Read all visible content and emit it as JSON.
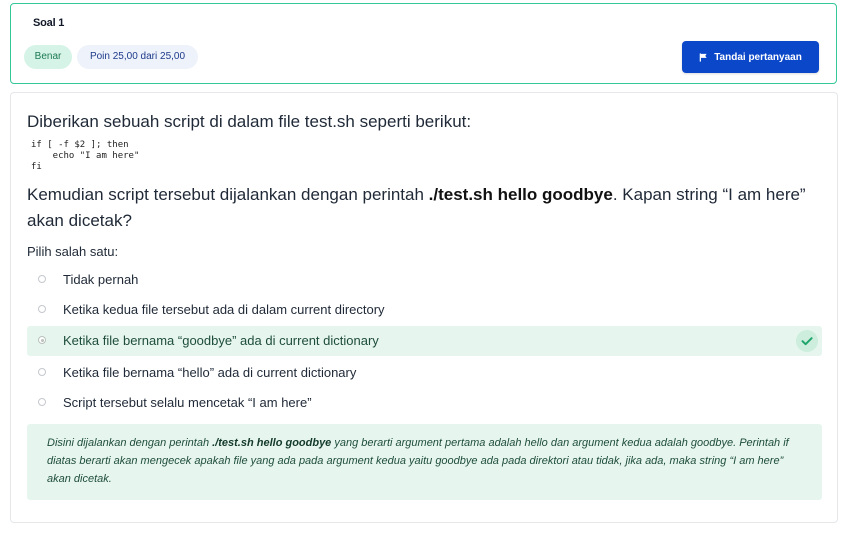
{
  "header": {
    "title": "Soal 1",
    "status_badge": "Benar",
    "points_badge": "Poin 25,00 dari 25,00",
    "flag_button": "Tandai pertanyaan"
  },
  "question": {
    "intro": "Diberikan sebuah script di dalam file test.sh seperti berikut:",
    "code": "if [ -f $2 ]; then\n    echo \"I am here\"\nfi",
    "text_before": "Kemudian script tersebut dijalankan dengan perintah ",
    "command": "./test.sh hello goodbye",
    "text_after": ". Kapan string “I am here” akan dicetak?",
    "choose_label": "Pilih salah satu:"
  },
  "options": [
    {
      "label": "Tidak pernah",
      "selected": false
    },
    {
      "label": "Ketika kedua file tersebut ada di dalam current directory",
      "selected": false
    },
    {
      "label": "Ketika file bernama “goodbye” ada di current dictionary",
      "selected": true
    },
    {
      "label": "Ketika file bernama “hello” ada di current dictionary",
      "selected": false
    },
    {
      "label": "Script tersebut selalu mencetak “I am here”",
      "selected": false
    }
  ],
  "feedback": {
    "before": "Disini dijalankan dengan perintah ",
    "command": "./test.sh hello goodbye",
    "after": " yang berarti argument pertama adalah hello dan argument kedua adalah goodbye. Perintah if diatas berarti akan mengecek apakah file yang ada pada argument kedua yaitu goodbye ada pada direktori atau tidak, jika ada, maka string “I am here” akan dicetak."
  },
  "colors": {
    "accent": "#0b47c9",
    "correct_border": "#34c79a",
    "correct_bg": "#e6f6ef",
    "check": "#1fa56b"
  },
  "icons": {
    "flag": "flag-icon",
    "check": "check-icon"
  }
}
